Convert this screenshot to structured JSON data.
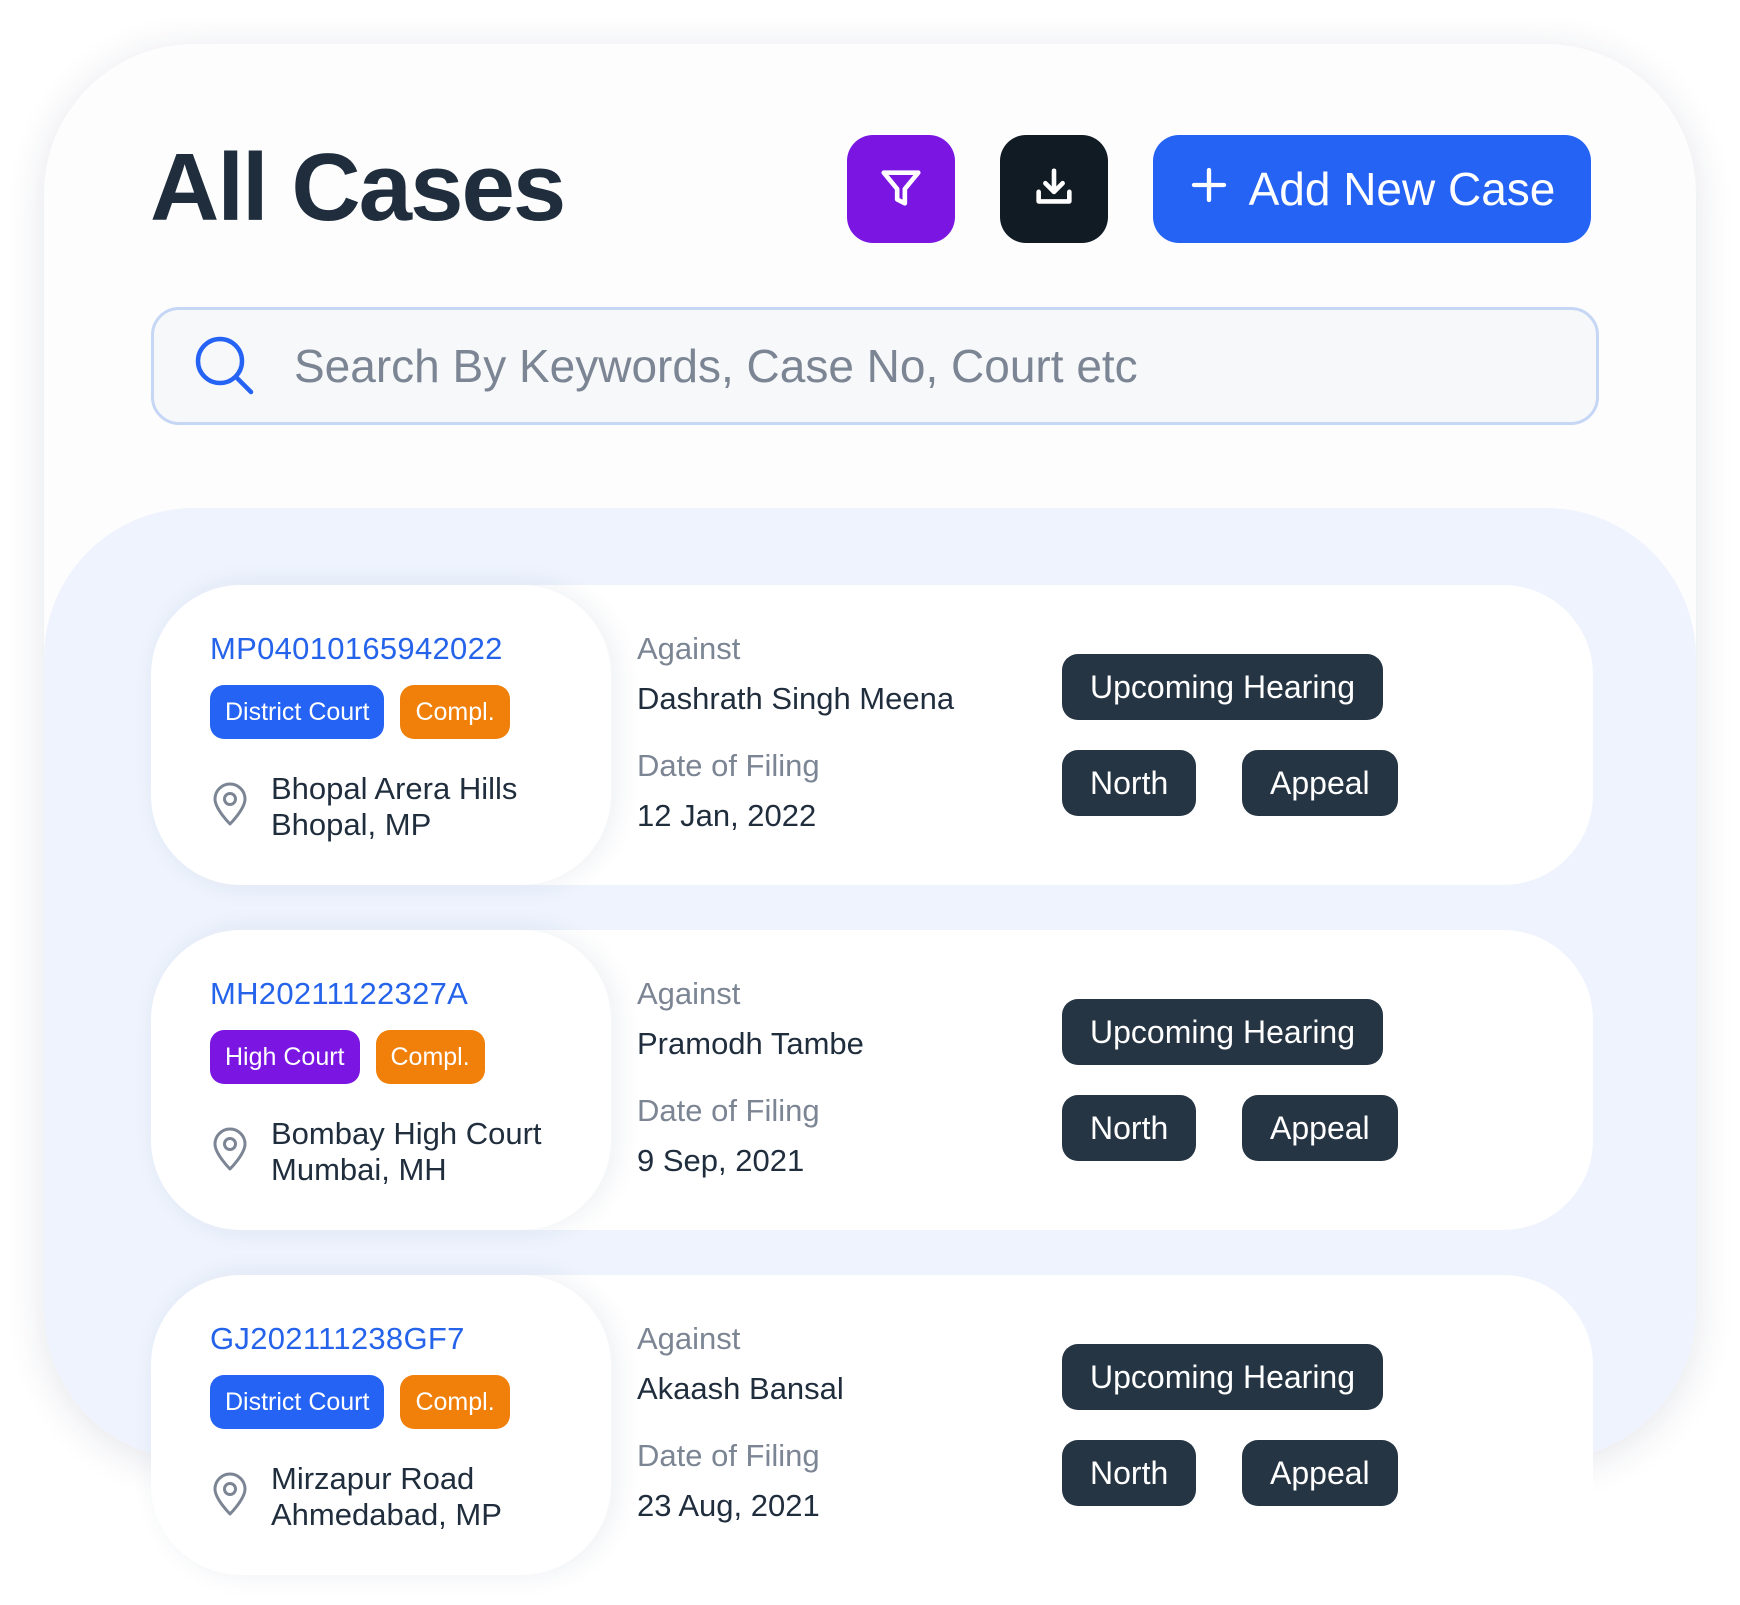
{
  "header": {
    "title": "All Cases",
    "add_label": "Add New Case"
  },
  "icons": {
    "filter": "filter-funnel-icon",
    "download": "download-icon",
    "add": "plus-icon",
    "search": "search-icon",
    "location": "map-pin-icon"
  },
  "search": {
    "placeholder": "Search By Keywords, Case No, Court etc",
    "value": ""
  },
  "labels": {
    "against": "Against",
    "date_of_filing": "Date of Filing"
  },
  "cases": [
    {
      "case_no": "MP04010165942022",
      "court": "District Court",
      "status": "Compl.",
      "location_line1": "Bhopal Arera Hills",
      "location_line2": "Bhopal, MP",
      "against": "Dashrath Singh Meena",
      "date": "12 Jan, 2022",
      "hearing": "Upcoming Hearing",
      "region": "North",
      "type": "Appeal"
    },
    {
      "case_no": "MH20211122327A",
      "court": "High Court",
      "status": "Compl.",
      "location_line1": "Bombay High Court",
      "location_line2": "Mumbai, MH",
      "against": "Pramodh Tambe",
      "date": "9 Sep, 2021",
      "hearing": "Upcoming Hearing",
      "region": "North",
      "type": "Appeal"
    },
    {
      "case_no": "GJ202111238GF7",
      "court": "District Court",
      "status": "Compl.",
      "location_line1": "Mirzapur Road",
      "location_line2": "Ahmedabad, MP",
      "against": "Akaash Bansal",
      "date": "23 Aug, 2021",
      "hearing": "Upcoming Hearing",
      "region": "North",
      "type": "Appeal"
    }
  ],
  "colors": {
    "primary_blue": "#2563f5",
    "purple": "#7b16e2",
    "orange": "#f0800a",
    "dark": "#111b24",
    "pill_dark": "#263544",
    "list_bg": "#eef3fd"
  }
}
